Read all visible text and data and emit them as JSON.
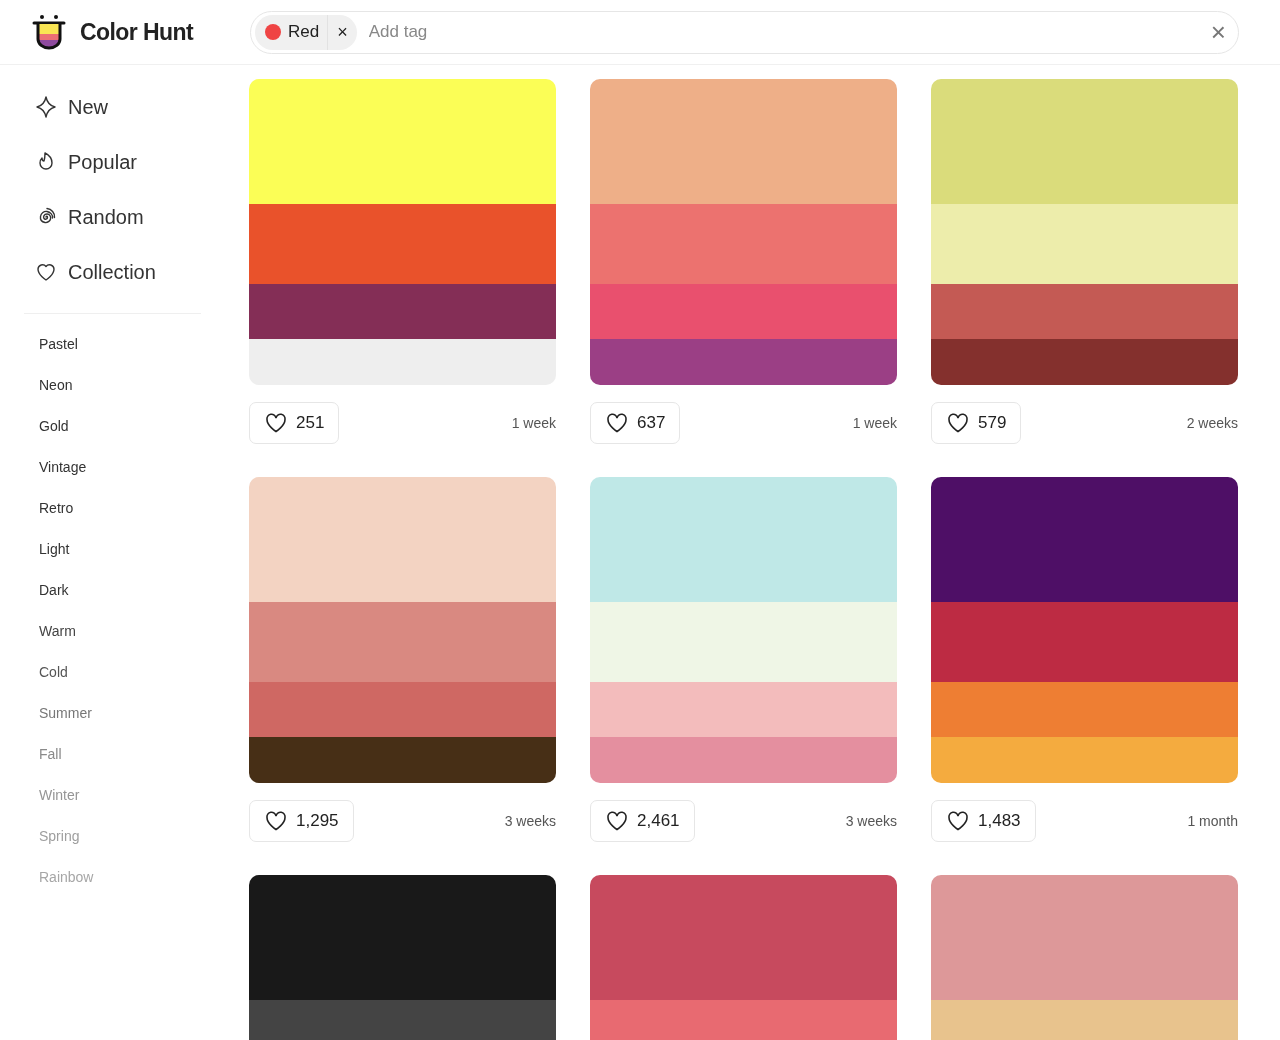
{
  "brand": {
    "name": "Color Hunt"
  },
  "search": {
    "tags": [
      {
        "label": "Red",
        "color": "#ef4444",
        "remove": "×"
      }
    ],
    "placeholder": "Add tag",
    "clear": "×"
  },
  "sidebar": {
    "nav": [
      {
        "kind": "new",
        "label": "New"
      },
      {
        "kind": "popular",
        "label": "Popular"
      },
      {
        "kind": "random",
        "label": "Random"
      },
      {
        "kind": "collection",
        "label": "Collection"
      }
    ],
    "tags": [
      "Pastel",
      "Neon",
      "Gold",
      "Vintage",
      "Retro",
      "Light",
      "Dark",
      "Warm",
      "Cold",
      "Summer",
      "Fall",
      "Winter",
      "Spring",
      "Rainbow"
    ]
  },
  "palettes": [
    {
      "swatches": [
        {
          "color": "#fbfe56"
        },
        {
          "color": "#e9522b"
        },
        {
          "color": "#842e56"
        },
        {
          "color": "#eeeeee"
        }
      ],
      "likes": "251",
      "age": "1 week"
    },
    {
      "swatches": [
        {
          "color": "#eeaf88"
        },
        {
          "color": "#ec726f"
        },
        {
          "color": "#e9506e"
        },
        {
          "color": "#9b3f85"
        }
      ],
      "likes": "637",
      "age": "1 week"
    },
    {
      "swatches": [
        {
          "color": "#dadc7b"
        },
        {
          "color": "#ededab"
        },
        {
          "color": "#c45a54"
        },
        {
          "color": "#84302d"
        }
      ],
      "likes": "579",
      "age": "2 weeks"
    },
    {
      "swatches": [
        {
          "color": "#f3d3c2"
        },
        {
          "color": "#d98981"
        },
        {
          "color": "#cf6863"
        },
        {
          "color": "#472f16"
        }
      ],
      "likes": "1,295",
      "age": "3 weeks"
    },
    {
      "swatches": [
        {
          "color": "#bfe8e7"
        },
        {
          "color": "#eff6e6"
        },
        {
          "color": "#f3bcbc"
        },
        {
          "color": "#e48f9f"
        }
      ],
      "likes": "2,461",
      "age": "3 weeks"
    },
    {
      "swatches": [
        {
          "color": "#4e0f66"
        },
        {
          "color": "#bd2b43"
        },
        {
          "color": "#ee7e33"
        },
        {
          "color": "#f4ab3f"
        }
      ],
      "likes": "1,483",
      "age": "1 month"
    },
    {
      "swatches": [
        {
          "color": "#191919"
        },
        {
          "color": "#444444"
        }
      ]
    },
    {
      "swatches": [
        {
          "color": "#c74a5e"
        },
        {
          "color": "#e86a71"
        }
      ]
    },
    {
      "swatches": [
        {
          "color": "#dd9899"
        },
        {
          "color": "#e8c38d"
        }
      ]
    }
  ]
}
